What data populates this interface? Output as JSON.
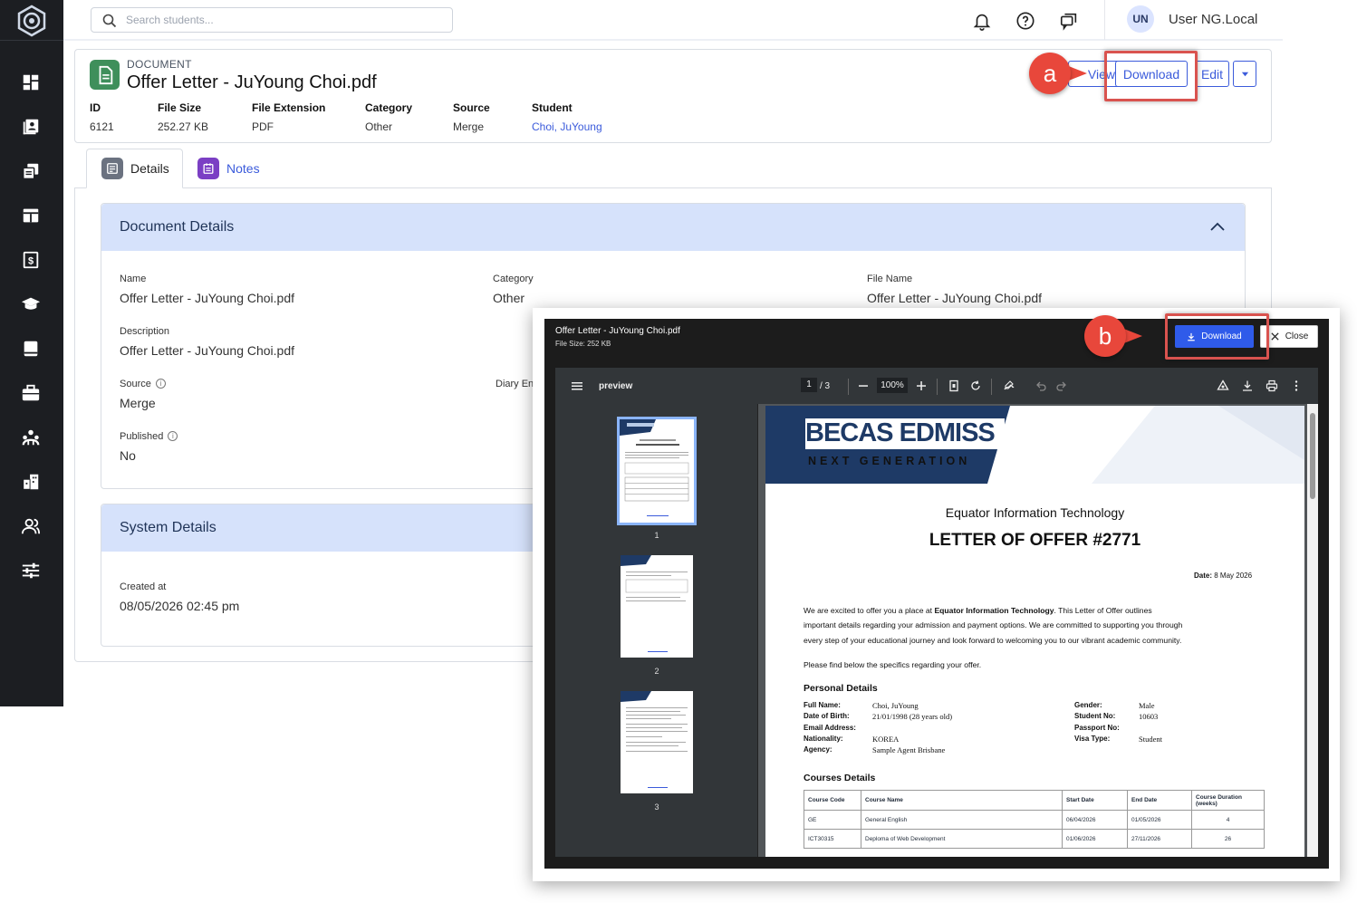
{
  "topbar": {
    "search_placeholder": "Search students...",
    "avatar_initials": "UN",
    "username": "User NG.Local"
  },
  "document": {
    "kicker": "DOCUMENT",
    "title": "Offer Letter - JuYoung Choi.pdf",
    "meta": [
      {
        "label": "ID",
        "value": "6121"
      },
      {
        "label": "File Size",
        "value": "252.27 KB"
      },
      {
        "label": "File Extension",
        "value": "PDF"
      },
      {
        "label": "Category",
        "value": "Other"
      },
      {
        "label": "Source",
        "value": "Merge"
      },
      {
        "label": "Student",
        "value": "Choi, JuYoung"
      }
    ],
    "actions": {
      "view": "View",
      "download": "Download",
      "edit": "Edit"
    }
  },
  "callouts": {
    "a": "a",
    "b": "b"
  },
  "tabs": [
    {
      "label": "Details"
    },
    {
      "label": "Notes"
    }
  ],
  "document_details": {
    "title": "Document Details",
    "fields": {
      "name_label": "Name",
      "name_value": "Offer Letter - JuYoung Choi.pdf",
      "category_label": "Category",
      "category_value": "Other",
      "file_name_label": "File Name",
      "file_name_value": "Offer Letter - JuYoung Choi.pdf",
      "description_label": "Description",
      "description_value": "Offer Letter - JuYoung Choi.pdf",
      "source_label": "Source",
      "source_value": "Merge",
      "diary_label": "Diary En",
      "published_label": "Published",
      "published_value": "No"
    }
  },
  "system_details": {
    "title": "System Details",
    "created_label": "Created at",
    "created_value": "08/05/2026 02:45 pm"
  },
  "viewer": {
    "title": "Offer Letter - JuYoung Choi.pdf",
    "file_size": "File Size: 252 KB",
    "download_label": "Download",
    "close_label": "Close",
    "toolbar": {
      "name": "preview",
      "page": "1",
      "of": "/ 3",
      "zoom": "100%"
    },
    "thumb_numbers": [
      "1",
      "2",
      "3"
    ],
    "page": {
      "logo_main": "BECAS EDMISS",
      "logo_sub": "NEXT GENERATION",
      "org": "Equator Information Technology",
      "heading": "LETTER OF OFFER #2771",
      "date_label": "Date:",
      "date_value": "8 May 2026",
      "para1_a": "We are excited to offer you a place at ",
      "para1_b": "Equator Information Technology",
      "para1_c": ". This Letter of Offer outlines",
      "para1_line2": "important details regarding your admission and payment options. We are committed to supporting you through",
      "para1_line3": "every step of your educational journey and look forward to welcoming you to our vibrant academic community.",
      "para2": "Please find below the specifics regarding your offer.",
      "personal_title": "Personal Details",
      "personal_left": [
        {
          "label": "Full Name:",
          "value": "Choi, JuYoung"
        },
        {
          "label": "Date of Birth:",
          "value": "21/01/1998 (28 years old)"
        },
        {
          "label": "Email Address:",
          "value": ""
        },
        {
          "label": "Nationality:",
          "value": "KOREA"
        },
        {
          "label": "Agency:",
          "value": "Sample Agent Brisbane"
        }
      ],
      "personal_right": [
        {
          "label": "Gender:",
          "value": "Male"
        },
        {
          "label": "Student No:",
          "value": "10603"
        },
        {
          "label": "Passport No:",
          "value": ""
        },
        {
          "label": "Visa Type:",
          "value": "Student"
        }
      ],
      "courses_title": "Courses Details",
      "courses_headers": [
        "Course Code",
        "Course Name",
        "Start Date",
        "End Date",
        "Course Duration (weeks)"
      ],
      "courses_rows": [
        [
          "GE",
          "General English",
          "06/04/2026",
          "01/05/2026",
          "4"
        ],
        [
          "ICT30315",
          "Deploma of Web Development",
          "01/06/2026",
          "27/11/2026",
          "26"
        ]
      ]
    }
  },
  "colors": {
    "accent": "#3b5bdb",
    "sidebar": "#1c1e22",
    "panel_header": "#d6e2fb",
    "callout": "#e8473b",
    "viewer_download": "#2f5bea"
  },
  "icons": [
    "logo-icon",
    "dashboard-icon",
    "students-icon",
    "documents-icon",
    "layout-icon",
    "finance-icon",
    "courses-icon",
    "book-icon",
    "briefcase-icon",
    "network-icon",
    "building-icon",
    "users-icon",
    "settings-sliders-icon",
    "search-icon",
    "bell-icon",
    "help-icon",
    "chat-icon"
  ]
}
